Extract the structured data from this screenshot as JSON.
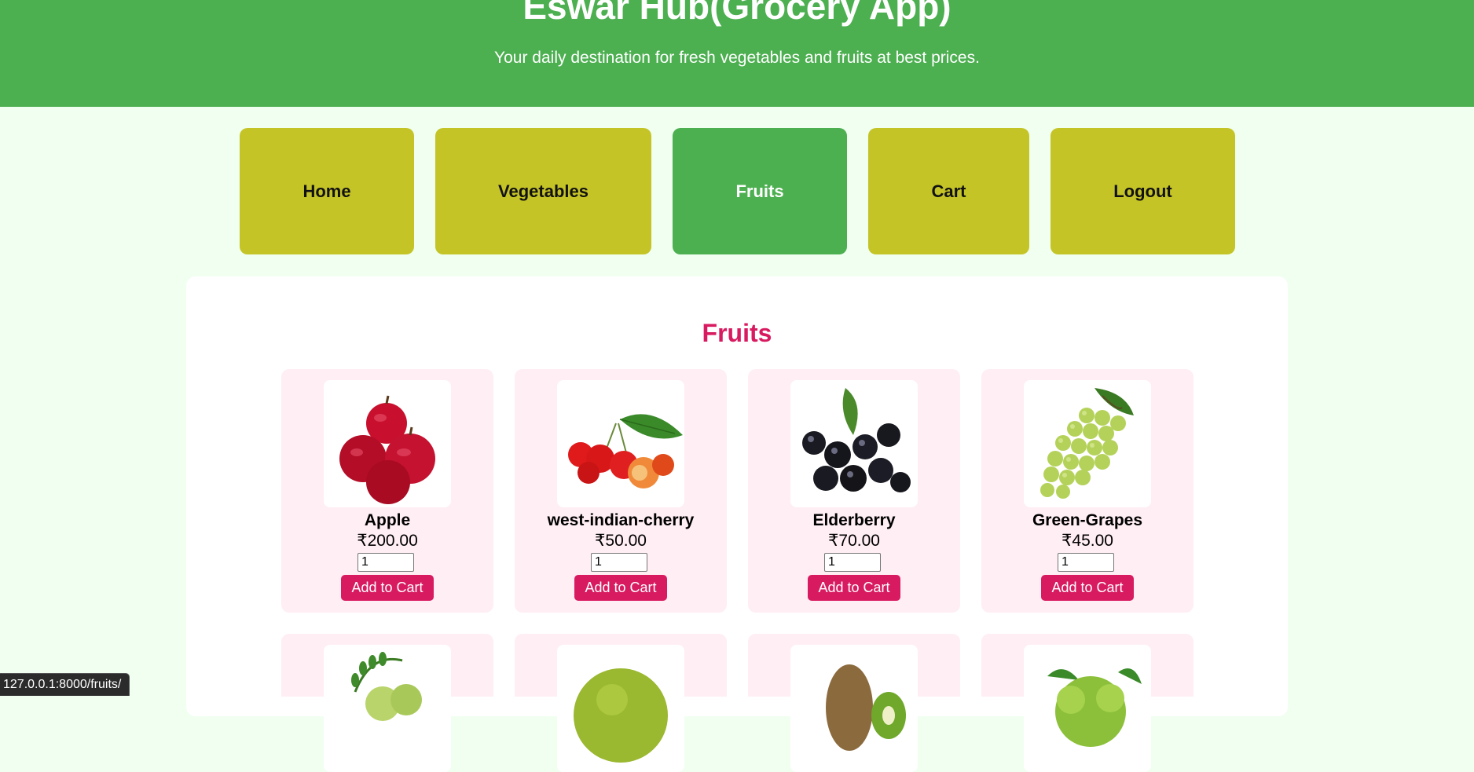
{
  "header": {
    "title": "Eswar Hub(Grocery App)",
    "subtitle": "Your daily destination for fresh vegetables and fruits at best prices."
  },
  "nav": {
    "items": [
      {
        "label": "Home"
      },
      {
        "label": "Vegetables"
      },
      {
        "label": "Fruits",
        "active": true
      },
      {
        "label": "Cart"
      },
      {
        "label": "Logout"
      }
    ]
  },
  "main": {
    "title": "Fruits",
    "products": [
      {
        "name": "Apple",
        "price": "₹200.00",
        "qty": "1",
        "button": "Add to Cart",
        "icon": "apple-image"
      },
      {
        "name": "west-indian-cherry",
        "price": "₹50.00",
        "qty": "1",
        "button": "Add to Cart",
        "icon": "west-indian-cherry-image"
      },
      {
        "name": "Elderberry",
        "price": "₹70.00",
        "qty": "1",
        "button": "Add to Cart",
        "icon": "elderberry-image"
      },
      {
        "name": "Green-Grapes",
        "price": "₹45.00",
        "qty": "1",
        "button": "Add to Cart",
        "icon": "green-grapes-image"
      }
    ],
    "more_products_icons": [
      "amla-image",
      "jackfruit-image",
      "kiwi-image",
      "bergamot-image"
    ]
  },
  "status_bar": {
    "url": "127.0.0.1:8000/fruits/"
  },
  "colors": {
    "header_bg": "#4caf50",
    "page_bg": "#f0fff0",
    "nav_button": "#c5c427",
    "nav_active": "#4caf50",
    "accent": "#d81b60",
    "card_bg": "#ffeef3"
  }
}
